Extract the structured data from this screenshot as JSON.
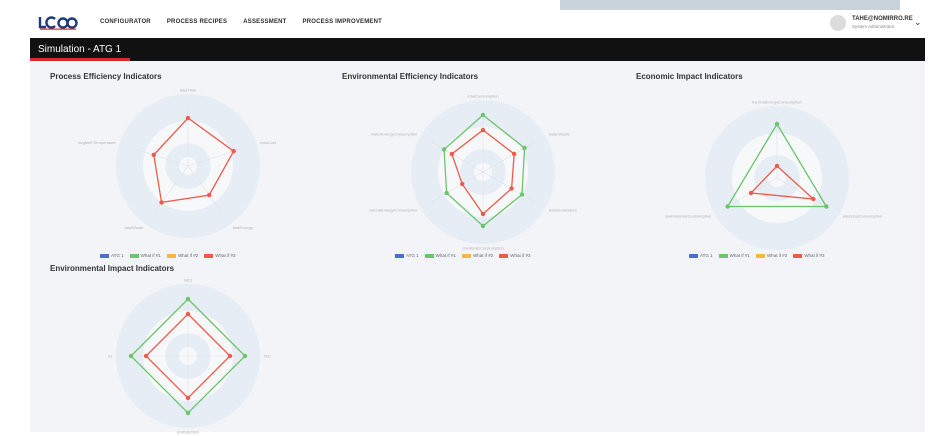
{
  "app": {
    "logo_text": "LCA"
  },
  "nav": [
    {
      "label": "CONFIGURATOR"
    },
    {
      "label": "PROCESS RECIPES"
    },
    {
      "label": "ASSESSMENT"
    },
    {
      "label": "PROCESS IMPROVEMENT"
    }
  ],
  "user": {
    "name": "TAHE@NOMIRRO.RE",
    "role": "System Administrator"
  },
  "simulation": {
    "title": "Simulation - ATG 1"
  },
  "legend": [
    {
      "label": "ATG 1",
      "color": "#4a6fc7"
    },
    {
      "label": "What if #1",
      "color": "#6cc46c"
    },
    {
      "label": "What if #2",
      "color": "#f5b642"
    },
    {
      "label": "What if #3",
      "color": "#ef5a4a"
    }
  ],
  "charts": [
    {
      "title": "Process Efficiency Indicators",
      "axes": [
        "totalTime",
        "totalCost",
        "totalEnergy",
        "totalWaste",
        "avgMelt Temperature"
      ],
      "series": [
        {
          "name": "What if #3",
          "values": [
            0.8,
            0.8,
            0.6,
            0.75,
            0.6
          ]
        }
      ]
    },
    {
      "title": "Environmental Efficiency Indicators",
      "axes": [
        "totalConsumption",
        "waterWaste",
        "wasteIndicators",
        "chemicalsConsumption",
        "naturalEnergyConsumption",
        "waterEnergyConsumption"
      ],
      "series": [
        {
          "name": "What if #1",
          "values": [
            0.95,
            0.8,
            0.75,
            0.9,
            0.7,
            0.75
          ]
        },
        {
          "name": "What if #3",
          "values": [
            0.7,
            0.6,
            0.55,
            0.7,
            0.4,
            0.6
          ]
        }
      ]
    },
    {
      "title": "Economic Impact Indicators",
      "axes": [
        "thermalEnergyConsumption",
        "electricalConsumption",
        "rawMaterialsConsumption"
      ],
      "series": [
        {
          "name": "What if #1",
          "values": [
            0.9,
            0.95,
            0.95
          ]
        },
        {
          "name": "What if #3",
          "values": [
            0.2,
            0.7,
            0.5
          ]
        }
      ]
    },
    {
      "title": "Environmental Impact Indicators",
      "axes": [
        "WCI",
        "WU",
        "EMISSIONS",
        "GI"
      ],
      "series": [
        {
          "name": "What if #1",
          "values": [
            0.95,
            0.95,
            0.95,
            0.95
          ]
        },
        {
          "name": "What if #3",
          "values": [
            0.7,
            0.7,
            0.7,
            0.7
          ]
        }
      ]
    }
  ]
}
